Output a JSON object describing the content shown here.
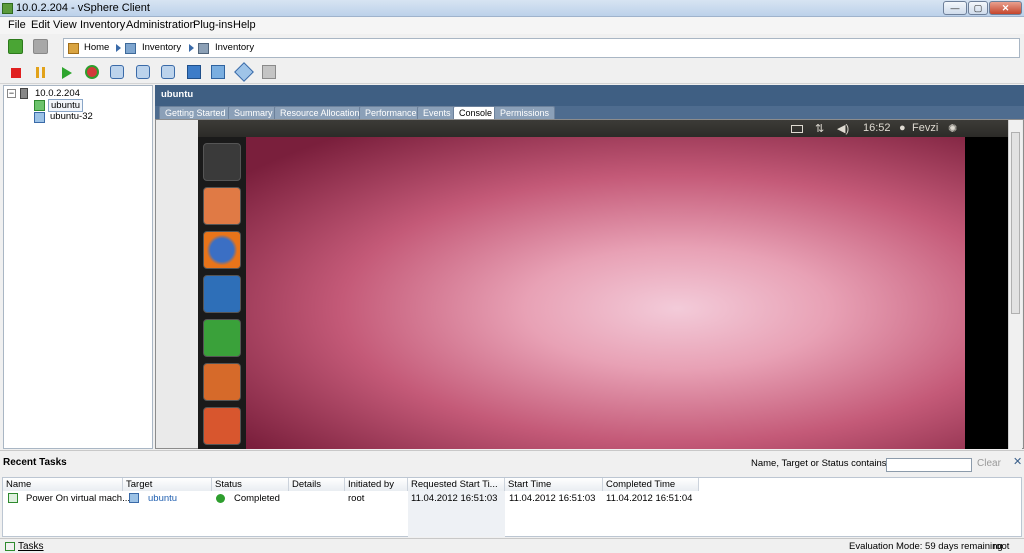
{
  "window": {
    "title": "10.0.2.204 - vSphere Client",
    "blurred_title": "",
    "min_label": "—",
    "max_label": "▢",
    "close_label": "✕"
  },
  "menu": {
    "items": [
      "File",
      "Edit",
      "View",
      "Inventory",
      "Administration",
      "Plug-ins",
      "Help"
    ]
  },
  "breadcrumb": {
    "home": "Home",
    "inventory1": "Inventory",
    "inventory2": "Inventory"
  },
  "tree": {
    "host": "10.0.2.204",
    "vm1": "ubuntu",
    "vm2": "ubuntu-32",
    "collapse": "−"
  },
  "vm": {
    "name": "ubuntu"
  },
  "tabs": [
    {
      "label": "Getting Started"
    },
    {
      "label": "Summary"
    },
    {
      "label": "Resource Allocation"
    },
    {
      "label": "Performance"
    },
    {
      "label": "Events"
    },
    {
      "label": "Console"
    },
    {
      "label": "Permissions"
    }
  ],
  "console": {
    "time": "16:52",
    "user": "Fevzi"
  },
  "recent_tasks": {
    "title": "Recent Tasks",
    "filter_label": "Name, Target or Status contains: ▾",
    "filter_value": "",
    "clear_label": "Clear",
    "close_label": "✕",
    "columns": [
      "Name",
      "Target",
      "Status",
      "Details",
      "Initiated by",
      "Requested Start Ti...",
      "Start Time",
      "Completed Time"
    ],
    "rows": [
      {
        "name": "Power On virtual mach...",
        "target": "ubuntu",
        "status": "Completed",
        "details": "",
        "initiated_by": "root",
        "requested": "11.04.2012 16:51:03",
        "start": "11.04.2012 16:51:03",
        "completed": "11.04.2012 16:51:04"
      }
    ]
  },
  "statusbar": {
    "tasks": "Tasks",
    "evaluation": "Evaluation Mode: 59 days remaining",
    "user": "root"
  },
  "colors": {
    "header": "#3f5f83",
    "accent": "#3a6aa8",
    "completed": "#2e9e2e"
  }
}
